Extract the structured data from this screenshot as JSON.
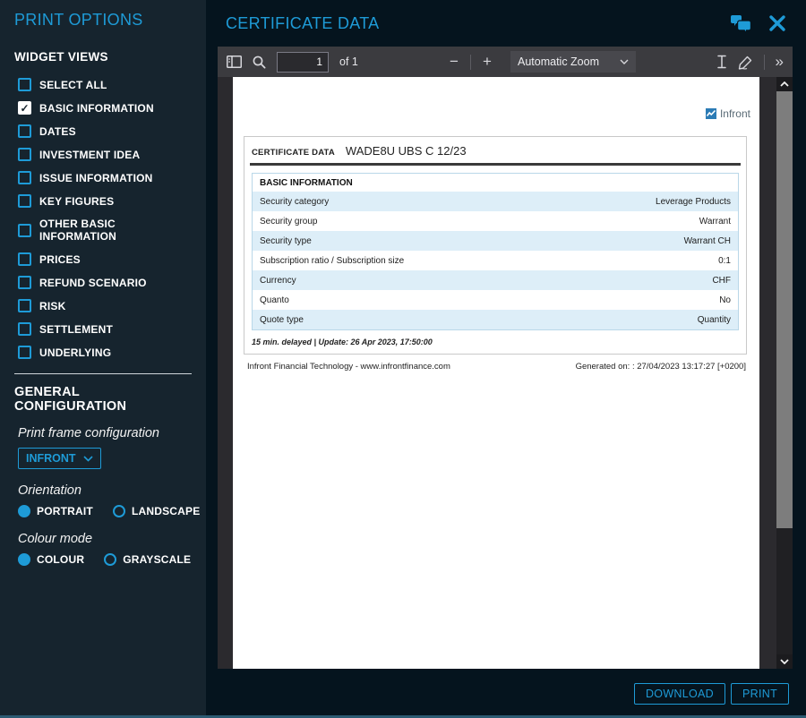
{
  "colors": {
    "accent": "#1e9bd7",
    "row_stripe": "#ddeef8",
    "sidebar_bg": "#16242e",
    "main_bg": "#05141e",
    "toolbar_bg": "#3b3b3f"
  },
  "icons": {
    "check": "✓",
    "minus": "−",
    "plus": "+",
    "double_chevron": "»"
  },
  "sidebar": {
    "title": "PRINT OPTIONS",
    "widget_views_heading": "WIDGET VIEWS",
    "items": [
      {
        "label": "SELECT ALL",
        "checked": false
      },
      {
        "label": "BASIC INFORMATION",
        "checked": true
      },
      {
        "label": "DATES",
        "checked": false
      },
      {
        "label": "INVESTMENT IDEA",
        "checked": false
      },
      {
        "label": "ISSUE INFORMATION",
        "checked": false
      },
      {
        "label": "KEY FIGURES",
        "checked": false
      },
      {
        "label": "OTHER BASIC INFORMATION",
        "checked": false
      },
      {
        "label": "PRICES",
        "checked": false
      },
      {
        "label": "REFUND SCENARIO",
        "checked": false
      },
      {
        "label": "RISK",
        "checked": false
      },
      {
        "label": "SETTLEMENT",
        "checked": false
      },
      {
        "label": "UNDERLYING",
        "checked": false
      }
    ],
    "general": {
      "heading": "GENERAL CONFIGURATION",
      "print_frame_label": "Print frame configuration",
      "print_frame_value": "INFRONT",
      "orientation_label": "Orientation",
      "orientation_options": [
        {
          "label": "PORTRAIT",
          "selected": true
        },
        {
          "label": "LANDSCAPE",
          "selected": false
        }
      ],
      "colour_mode_label": "Colour mode",
      "colour_mode_options": [
        {
          "label": "COLOUR",
          "selected": true
        },
        {
          "label": "GRAYSCALE",
          "selected": false
        }
      ]
    }
  },
  "header": {
    "title": "CERTIFICATE DATA"
  },
  "toolbar": {
    "page_value": "1",
    "page_count_label": "of 1",
    "zoom_value": "Automatic Zoom"
  },
  "document": {
    "brand": "Infront",
    "title_label": "CERTIFICATE DATA",
    "title_value": "WADE8U UBS C 12/23",
    "section_heading": "BASIC INFORMATION",
    "rows": [
      {
        "label": "Security category",
        "value": "Leverage Products"
      },
      {
        "label": "Security group",
        "value": "Warrant"
      },
      {
        "label": "Security type",
        "value": "Warrant CH"
      },
      {
        "label": "Subscription ratio / Subscription size",
        "value": "0:1"
      },
      {
        "label": "Currency",
        "value": "CHF"
      },
      {
        "label": "Quanto",
        "value": "No"
      },
      {
        "label": "Quote type",
        "value": "Quantity"
      }
    ],
    "delayed_note": "15 min. delayed | Update: 26 Apr 2023, 17:50:00",
    "footer_left": "Infront Financial Technology - www.infrontfinance.com",
    "footer_right": "Generated on: : 27/04/2023 13:17:27 [+0200]"
  },
  "footer": {
    "download_label": "DOWNLOAD",
    "print_label": "PRINT"
  }
}
